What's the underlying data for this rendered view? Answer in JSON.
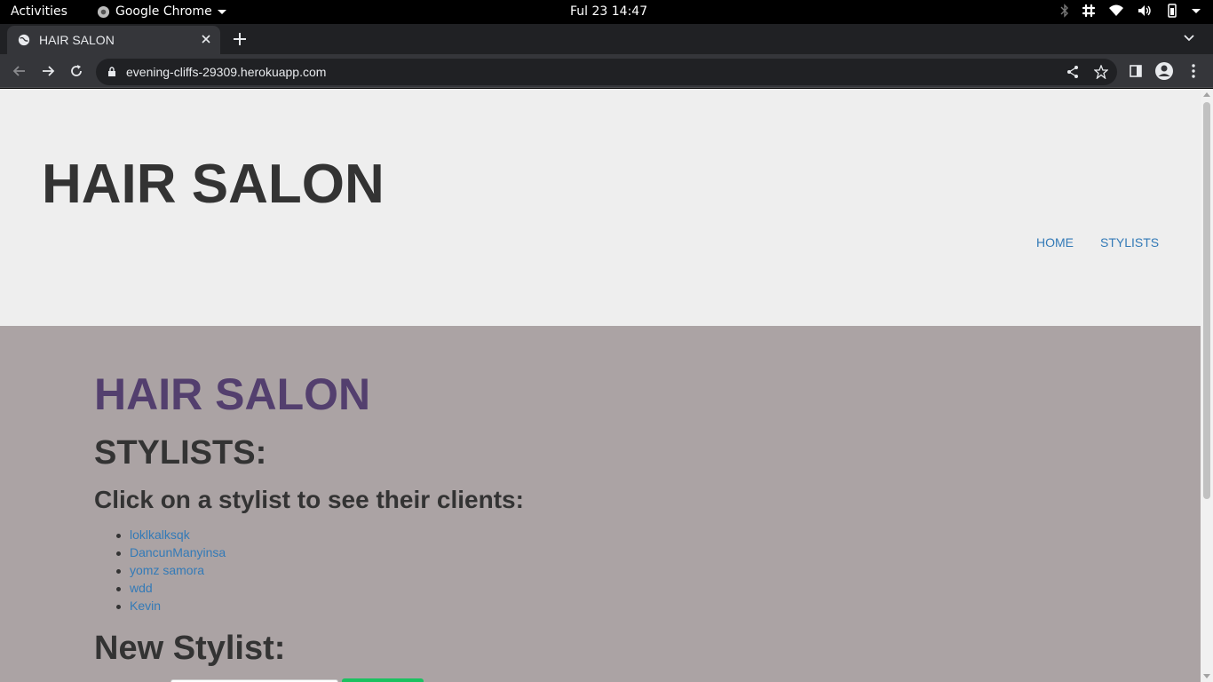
{
  "os_bar": {
    "activities": "Activities",
    "app_name": "Google Chrome",
    "clock": "Ful 23  14:47"
  },
  "browser": {
    "tab_title": "HAIR SALON",
    "url": "evening-cliffs-29309.herokuapp.com"
  },
  "site": {
    "header_title": "HAIR SALON",
    "nav": {
      "home": "HOME",
      "stylists": "STYLISTS"
    }
  },
  "main": {
    "title": "HAIR SALON",
    "stylists_heading": "STYLISTS:",
    "instruction": "Click on a stylist to see their clients:",
    "stylists": [
      "loklkalksqk",
      "DancunManyinsa",
      "yomz samora",
      "wdd",
      "Kevin"
    ],
    "new_heading": "New Stylist:"
  },
  "colors": {
    "header_bg": "#eeeeee",
    "main_bg": "#aba3a4",
    "title_purple": "#533f6e",
    "link_blue": "#337ab7",
    "button_green": "#1bc160"
  }
}
